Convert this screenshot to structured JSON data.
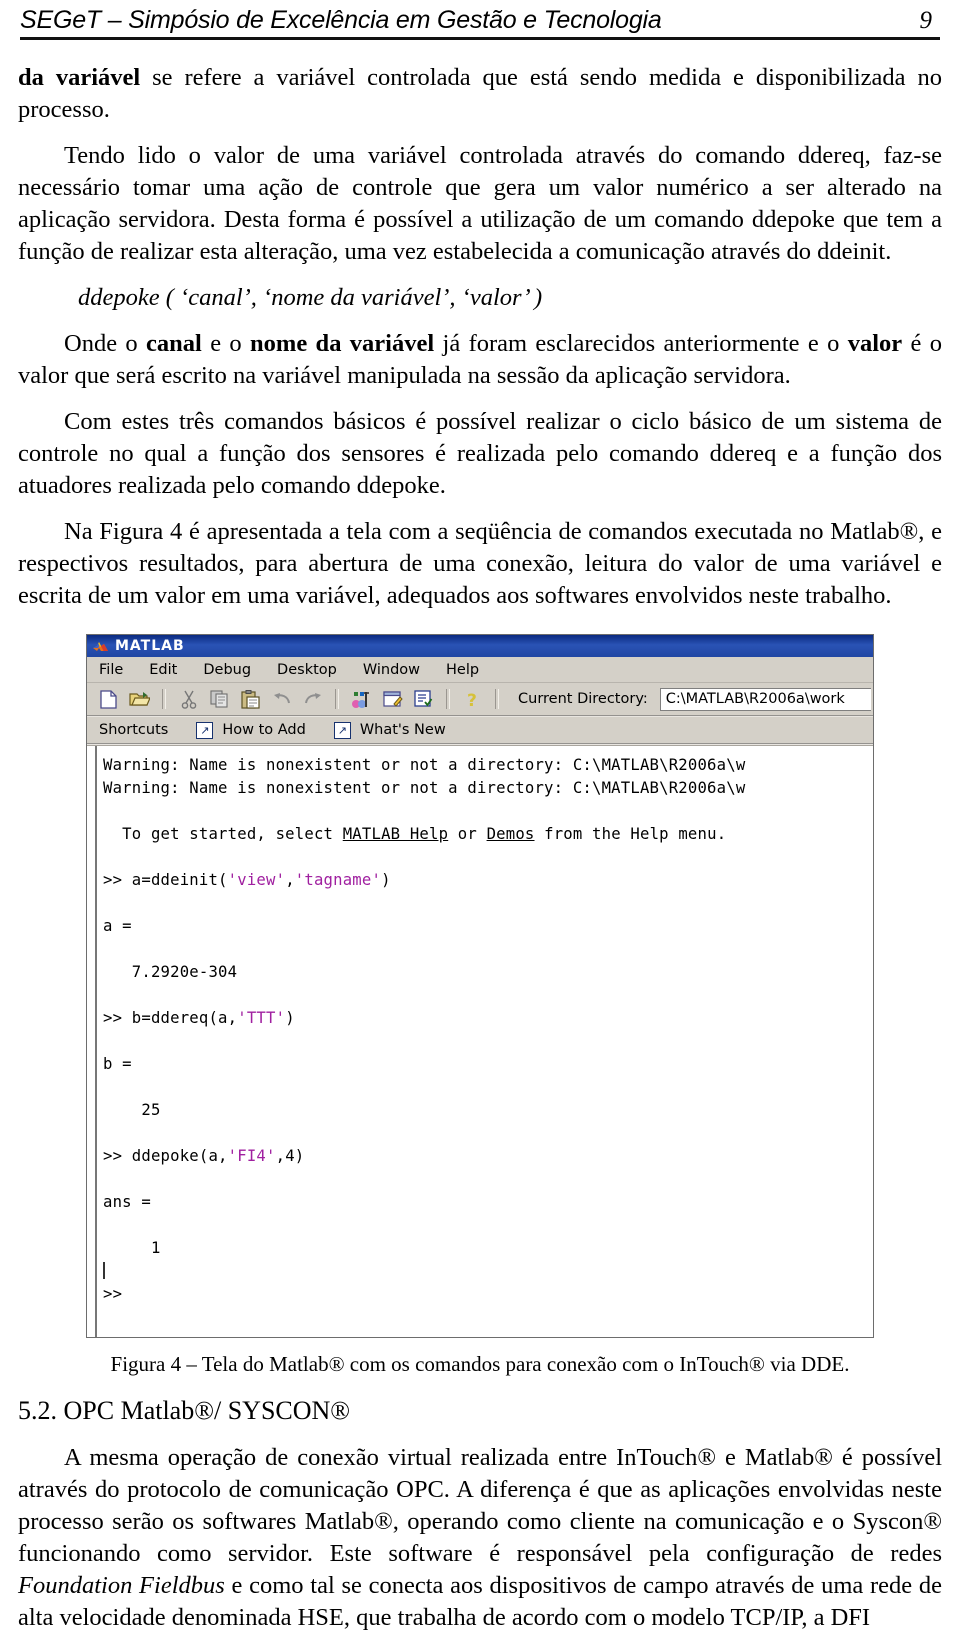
{
  "header": {
    "title": "SEGeT – Simpósio de Excelência em Gestão e Tecnologia",
    "page_number": "9"
  },
  "body": {
    "para1_bold": "da variável",
    "para1_rest": " se refere a variável controlada que está sendo medida e disponibilizada no processo.",
    "para2": "Tendo lido o valor de uma variável controlada através do comando ddereq, faz-se necessário tomar uma ação de controle que gera um valor numérico a ser alterado na aplicação servidora. Desta forma é possível a utilização de um comando ddepoke que tem a função de realizar esta alteração, uma vez estabelecida a comunicação através do ddeinit.",
    "code_signature": "ddepoke ( ‘canal’, ‘nome da variável’, ‘valor’ )",
    "para3_a": "Onde o ",
    "para3_b1": "canal",
    "para3_c": " e o ",
    "para3_b2": "nome da variável",
    "para3_d": " já foram esclarecidos anteriormente e o ",
    "para3_b3": "valor",
    "para3_e": " é o valor que será escrito na variável manipulada na sessão da aplicação servidora.",
    "para4": "Com estes três comandos básicos é possível realizar o ciclo básico de um sistema de controle no qual a função dos sensores é realizada pelo comando ddereq e a função dos atuadores realizada pelo comando ddepoke.",
    "para5": "Na Figura 4 é apresentada a tela com a seqüência de comandos executada no Matlab®, e respectivos resultados, para abertura de uma conexão, leitura do valor de uma variável e escrita de um valor em uma variável, adequados aos softwares envolvidos neste trabalho.",
    "figure_caption": "Figura 4 – Tela do Matlab® com os comandos para conexão com o InTouch® via DDE.",
    "section_heading": "5.2. OPC Matlab®/ SYSCON®",
    "para6_a": "A mesma operação de conexão virtual realizada entre InTouch® e Matlab® é possível através do protocolo de comunicação OPC. A diferença é que as aplicações envolvidas neste processo serão os softwares Matlab®, operando como cliente na comunicação e o Syscon® funcionando como servidor. Este software é responsável pela configuração de redes ",
    "para6_italic": "Foundation Fieldbus",
    "para6_b": " e como tal se conecta aos dispositivos de campo através de uma rede de alta velocidade denominada HSE, que trabalha de acordo com o modelo TCP/IP, a DFI"
  },
  "matlab_window": {
    "title": "MATLAB",
    "menus": [
      "File",
      "Edit",
      "Debug",
      "Desktop",
      "Window",
      "Help"
    ],
    "toolbar_icons": [
      "new-file-icon",
      "open-folder-icon",
      "cut-icon",
      "copy-icon",
      "paste-icon",
      "undo-icon",
      "redo-icon",
      "simulink-icon",
      "editor-icon",
      "profiler-icon",
      "help-icon"
    ],
    "current_directory_label": "Current Directory:",
    "current_directory_value": "C:\\MATLAB\\R2006a\\work",
    "shortcuts_label": "Shortcuts",
    "shortcut_how_to_add": "How to Add",
    "shortcut_whats_new": "What's New",
    "shortcut_arrow_glyph": "↗",
    "console": {
      "warning1": "Warning: Name is nonexistent or not a directory: C:\\MATLAB\\R2006a\\w",
      "warning2": "Warning: Name is nonexistent or not a directory: C:\\MATLAB\\R2006a\\w",
      "getstarted_pre": "  To get started, select ",
      "getstarted_link1": "MATLAB Help",
      "getstarted_mid": " or ",
      "getstarted_link2": "Demos",
      "getstarted_post": " from the Help menu.",
      "cmd1_pre": ">> a=ddeinit(",
      "cmd1_s1": "'view'",
      "cmd1_mid": ",",
      "cmd1_s2": "'tagname'",
      "cmd1_post": ")",
      "out1_name": "a =",
      "out1_value": "   7.2920e-304",
      "cmd2_pre": ">> b=ddereq(a,",
      "cmd2_s1": "'TTT'",
      "cmd2_post": ")",
      "out2_name": "b =",
      "out2_value": "    25",
      "cmd3_pre": ">> ddepoke(a,",
      "cmd3_s1": "'FI4'",
      "cmd3_mid": ",4",
      "cmd3_post": ")",
      "out3_name": "ans =",
      "out3_value": "     1",
      "prompt": ">>"
    },
    "colors": {
      "titlebar": "#1f45a3",
      "chrome": "#d4d0c8",
      "string_literal": "#a020a0",
      "console_bg": "#ffffff"
    }
  }
}
